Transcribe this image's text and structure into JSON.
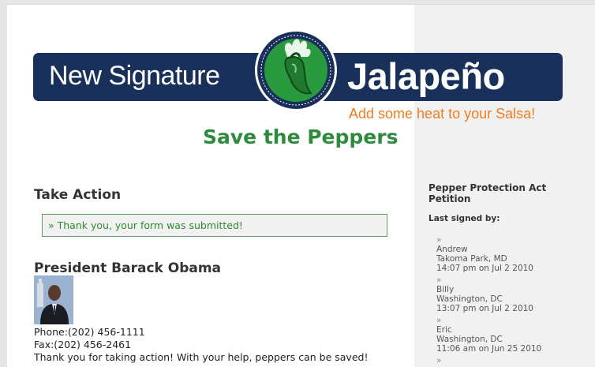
{
  "banner": {
    "left_text": "New Signature",
    "right_text": "Jalapeño",
    "tagline": "Add some heat to your Salsa!"
  },
  "page_title": "Save the Peppers",
  "take_action": {
    "heading": "Take Action",
    "notice": "» Thank you, your form was submitted!"
  },
  "target": {
    "name": "President Barack Obama",
    "phone": "Phone:(202) 456-1111",
    "fax": "Fax:(202) 456-2461",
    "thanks": "Thank you for taking action! With your help, peppers can be saved!"
  },
  "sidebar": {
    "title": "Pepper Protection Act Petition",
    "subtitle": "Last signed by:",
    "signers": [
      {
        "marker": "»",
        "name": "Andrew",
        "location": "Takoma Park, MD",
        "time": "14:07 pm on Jul 2 2010"
      },
      {
        "marker": "»",
        "name": "Billy",
        "location": "Washington, DC",
        "time": "13:07 pm on Jul 2 2010"
      },
      {
        "marker": "»",
        "name": "Eric",
        "location": "Washington, DC",
        "time": "11:06 am on Jun 25 2010"
      },
      {
        "marker": "»"
      }
    ]
  },
  "colors": {
    "navy": "#19305a",
    "green": "#2e8b3d",
    "orange": "#f47b20",
    "notice_border": "#5f9a5f"
  }
}
